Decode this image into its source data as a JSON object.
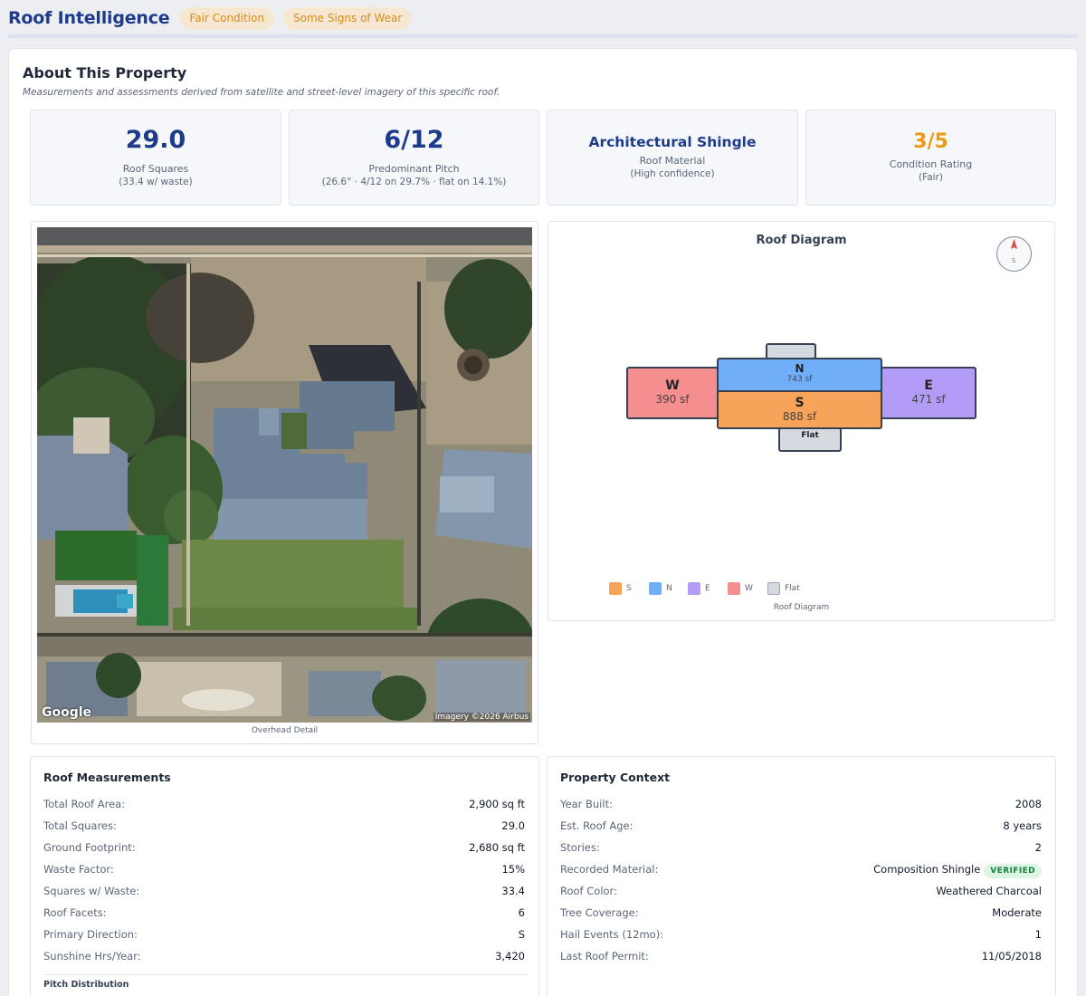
{
  "header": {
    "title": "Roof Intelligence",
    "badges": [
      "Fair Condition",
      "Some Signs of Wear"
    ]
  },
  "about": {
    "title": "About This Property",
    "subtitle": "Measurements and assessments derived from satellite and street-level imagery of this specific roof."
  },
  "stats": [
    {
      "value": "29.0",
      "label": "Roof Squares",
      "sub": "(33.4 w/ waste)"
    },
    {
      "value": "6/12",
      "label": "Predominant Pitch",
      "sub": "(26.6° · 4/12 on 29.7% · flat on 14.1%)"
    },
    {
      "value": "Architectural Shingle",
      "label": "Roof Material",
      "sub": "(High confidence)"
    },
    {
      "value": "3/5",
      "label": "Condition Rating",
      "sub": "(Fair)"
    }
  ],
  "overhead": {
    "caption": "Overhead Detail",
    "watermark": "Google",
    "credit": "Imagery ©2026 Airbus"
  },
  "diagram": {
    "title": "Roof Diagram",
    "caption": "Roof Diagram",
    "compass": "S",
    "facets": {
      "w": {
        "label": "W",
        "area": "390 sf"
      },
      "n": {
        "label": "N",
        "area": "743 sf"
      },
      "s": {
        "label": "S",
        "area": "888 sf"
      },
      "e": {
        "label": "E",
        "area": "471 sf"
      },
      "flat": {
        "label": "Flat"
      }
    },
    "legend": [
      "S",
      "N",
      "E",
      "W",
      "Flat"
    ],
    "colors": {
      "S": "#f8a35a",
      "N": "#71aefa",
      "E": "#b39bf8",
      "W": "#f58e8e",
      "Flat": "#d5d9e0"
    }
  },
  "measurements": {
    "title": "Roof Measurements",
    "rows": [
      {
        "k": "Total Roof Area:",
        "v": "2,900 sq ft"
      },
      {
        "k": "Total Squares:",
        "v": "29.0"
      },
      {
        "k": "Ground Footprint:",
        "v": "2,680 sq ft"
      },
      {
        "k": "Waste Factor:",
        "v": "15%"
      },
      {
        "k": "Squares w/ Waste:",
        "v": "33.4"
      },
      {
        "k": "Roof Facets:",
        "v": "6"
      },
      {
        "k": "Primary Direction:",
        "v": "S"
      },
      {
        "k": "Sunshine Hrs/Year:",
        "v": "3,420"
      }
    ],
    "pitch_title": "Pitch Distribution"
  },
  "context": {
    "title": "Property Context",
    "rows": [
      {
        "k": "Year Built:",
        "v": "2008"
      },
      {
        "k": "Est. Roof Age:",
        "v": "8 years"
      },
      {
        "k": "Stories:",
        "v": "2"
      },
      {
        "k": "Recorded Material:",
        "v": "Composition Shingle"
      },
      {
        "k": "Roof Color:",
        "v": "Weathered Charcoal"
      },
      {
        "k": "Tree Coverage:",
        "v": "Moderate"
      },
      {
        "k": "Hail Events (12mo):",
        "v": "1"
      },
      {
        "k": "Last Roof Permit:",
        "v": "11/05/2018"
      }
    ],
    "verified": "VERIFIED"
  }
}
